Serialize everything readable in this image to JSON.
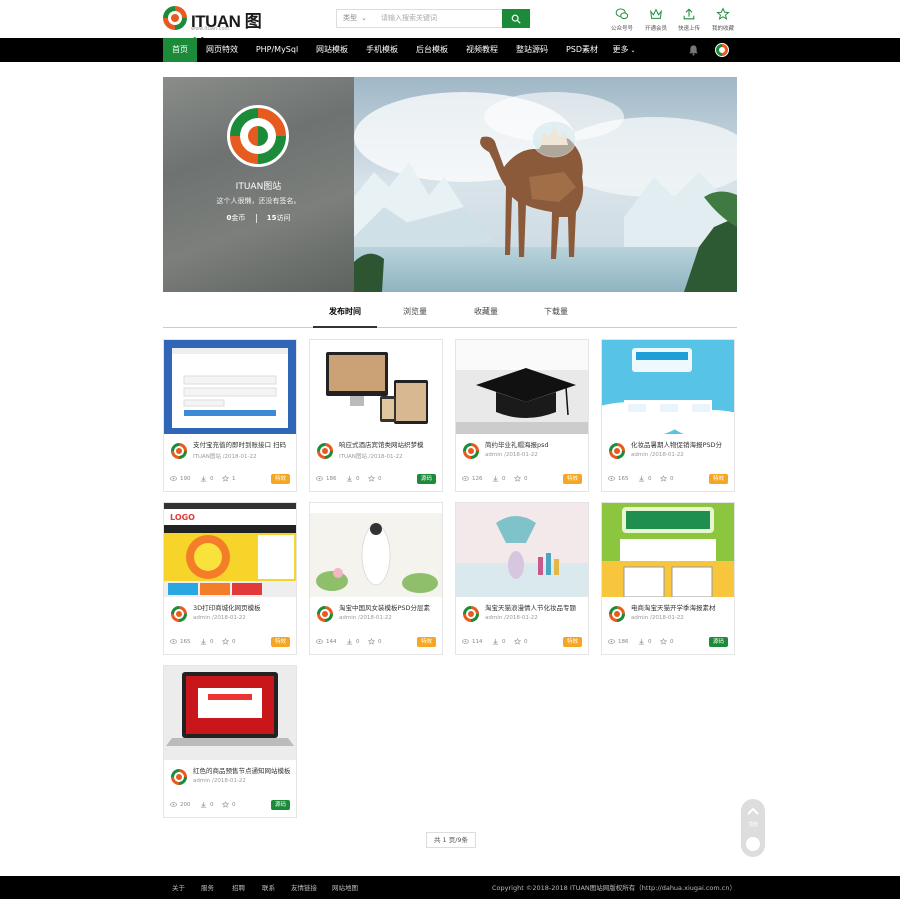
{
  "header": {
    "logo_text": "ITUAN",
    "logo_cn": "图站",
    "logo_sub": "www.ituan.com",
    "search": {
      "type_label": "类型",
      "placeholder": "请输入搜索关键词"
    },
    "tools": [
      {
        "label": "公众号号",
        "icon": "wechat-icon"
      },
      {
        "label": "开通会员",
        "icon": "crown-icon"
      },
      {
        "label": "快速上传",
        "icon": "upload-icon"
      },
      {
        "label": "我的收藏",
        "icon": "star-icon"
      }
    ]
  },
  "nav": {
    "items": [
      "首页",
      "网页特效",
      "PHP/MySql",
      "网站模板",
      "手机模板",
      "后台模板",
      "视频教程",
      "整站源码",
      "PSD素材",
      "更多"
    ],
    "active_index": 0,
    "accent": "#1b8b3a"
  },
  "profile": {
    "name": "ITUAN图站",
    "motto": "这个人很懒，还没有签名。",
    "coins_value": "0",
    "coins_label": "金币",
    "visits_value": "15",
    "visits_label": "访问"
  },
  "tabs": [
    "发布时间",
    "浏览量",
    "收藏量",
    "下载量"
  ],
  "cards": [
    {
      "title": "支付宝充值的即时到账接口 扫码",
      "author": "ITUAN图站",
      "date": "2018-01-22",
      "views": "190",
      "downloads": "0",
      "favs": "1",
      "tag": "特效",
      "tag_color": "orange",
      "thumb": "login"
    },
    {
      "title": "响应式酒店宾馆类网站织梦模",
      "author": "ITUAN图站",
      "date": "2018-01-22",
      "views": "186",
      "downloads": "0",
      "favs": "0",
      "tag": "源码",
      "tag_color": "green",
      "thumb": "devices"
    },
    {
      "title": "简约毕业礼帽海报psd",
      "author": "admin",
      "date": "2018-01-22",
      "views": "126",
      "downloads": "0",
      "favs": "0",
      "tag": "特效",
      "tag_color": "orange",
      "thumb": "cap"
    },
    {
      "title": "化妆品暑期人物促销海报PSD分",
      "author": "admin",
      "date": "2018-01-22",
      "views": "165",
      "downloads": "0",
      "favs": "0",
      "tag": "特效",
      "tag_color": "orange",
      "thumb": "summer"
    },
    {
      "title": "3D打印商城化网页模板",
      "author": "admin",
      "date": "2018-01-22",
      "views": "165",
      "downloads": "0",
      "favs": "0",
      "tag": "特效",
      "tag_color": "orange",
      "thumb": "shop"
    },
    {
      "title": "淘宝中国风女装模板PSD分层素",
      "author": "admin",
      "date": "2018-01-22",
      "views": "144",
      "downloads": "0",
      "favs": "0",
      "tag": "特效",
      "tag_color": "orange",
      "thumb": "chinese"
    },
    {
      "title": "淘宝天猫浪漫情人节化妆品专题",
      "author": "admin",
      "date": "2018-01-22",
      "views": "114",
      "downloads": "0",
      "favs": "0",
      "tag": "特效",
      "tag_color": "orange",
      "thumb": "valentine"
    },
    {
      "title": "电商淘宝天猫开学季海报素材",
      "author": "admin",
      "date": "2018-01-22",
      "views": "186",
      "downloads": "0",
      "favs": "0",
      "tag": "源码",
      "tag_color": "green",
      "thumb": "school"
    },
    {
      "title": "红色的商品预售节点通知网站模板",
      "author": "admin",
      "date": "2018-01-22",
      "views": "200",
      "downloads": "0",
      "favs": "0",
      "tag": "源码",
      "tag_color": "green",
      "thumb": "laptop"
    }
  ],
  "pager": {
    "text": "共 1 页/9条"
  },
  "float": {
    "label": "顶部"
  },
  "footer": {
    "links": [
      "关于",
      "服务",
      "招聘",
      "联系",
      "友情链接",
      "网站地图"
    ],
    "copyright": "Copyright ©2018-2018 ITUAN图站网版权所有（http://dahua.xiugai.com.cn）"
  }
}
